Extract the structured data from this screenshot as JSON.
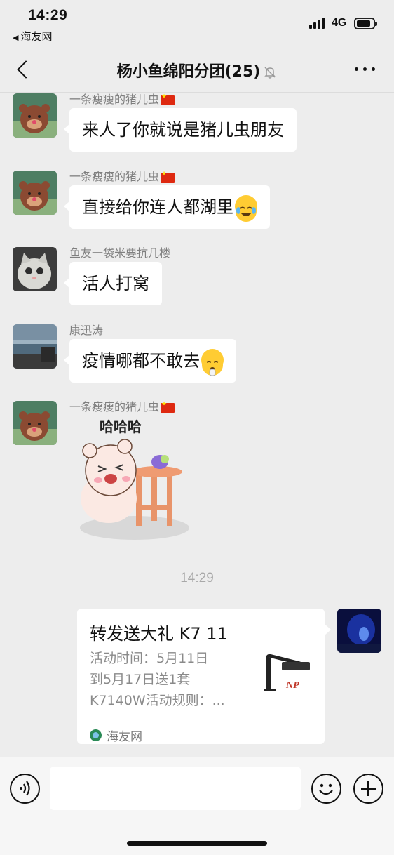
{
  "status_bar": {
    "time": "14:29",
    "back_app": "海友网",
    "network": "4G"
  },
  "nav": {
    "title": "杨小鱼绵阳分团(25)",
    "back_icon": "chevron-left-icon",
    "mute_icon": "bell-off-icon",
    "more_icon": "more-dots-icon"
  },
  "messages": [
    {
      "sender": "一条瘦瘦的猪儿虫",
      "flag": true,
      "text": "来人了你就说是猪儿虫朋友",
      "emoji": "",
      "avatar": "bear-avatar"
    },
    {
      "sender": "一条瘦瘦的猪儿虫",
      "flag": true,
      "text": "直接给你连人都湖里",
      "emoji": "laughing-tears-emoji",
      "avatar": "bear-avatar"
    },
    {
      "sender": "鱼友一袋米要抗几楼",
      "flag": false,
      "text": "活人打窝",
      "emoji": "",
      "avatar": "cat-avatar"
    },
    {
      "sender": "康迅涛",
      "flag": false,
      "text": "疫情哪都不敢去",
      "emoji": "shush-emoji",
      "avatar": "seascape-avatar"
    },
    {
      "sender": "一条瘦瘦的猪儿虫",
      "flag": true,
      "sticker_text": "哈哈哈",
      "sticker": "bear-laughing-sticker",
      "avatar": "bear-avatar"
    }
  ],
  "timestamp": "14:29",
  "card": {
    "title": "转发送大礼 K7 11",
    "desc_lines": [
      "活动时间：5月11日",
      "到5月17日送1套",
      "K7140W活动规则：..."
    ],
    "thumb_label": "NP",
    "source": "海友网"
  },
  "input_bar": {
    "voice_icon": "voice-icon",
    "emoji_icon": "emoji-face-icon",
    "plus_icon": "plus-icon",
    "placeholder": ""
  },
  "colors": {
    "background": "#ededed",
    "bubble": "#ffffff",
    "meta_text": "#7f7f7f"
  }
}
